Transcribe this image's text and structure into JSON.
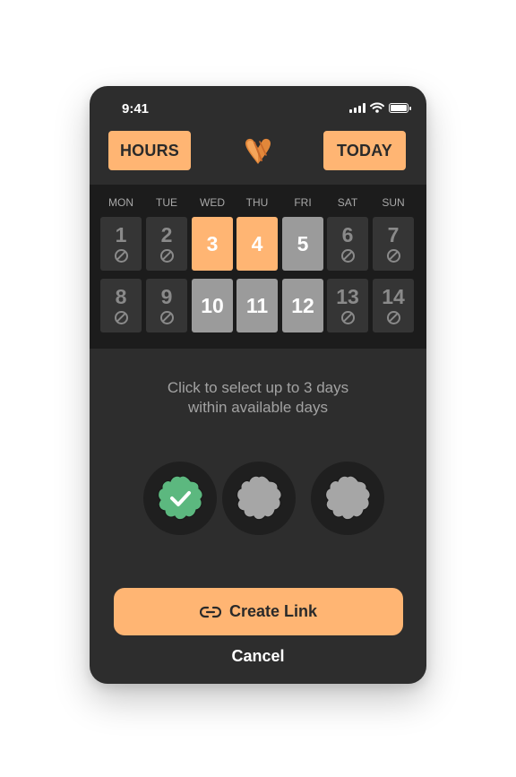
{
  "status_bar": {
    "time": "9:41"
  },
  "header": {
    "left_button": "HOURS",
    "right_button": "TODAY",
    "logo_icon": "heart-v-logo-icon"
  },
  "calendar": {
    "weekdays": [
      "MON",
      "TUE",
      "WED",
      "THU",
      "FRI",
      "SAT",
      "SUN"
    ],
    "weeks": [
      [
        {
          "day": "1",
          "state": "unavailable"
        },
        {
          "day": "2",
          "state": "unavailable"
        },
        {
          "day": "3",
          "state": "selected"
        },
        {
          "day": "4",
          "state": "selected"
        },
        {
          "day": "5",
          "state": "available"
        },
        {
          "day": "6",
          "state": "unavailable"
        },
        {
          "day": "7",
          "state": "unavailable"
        }
      ],
      [
        {
          "day": "8",
          "state": "unavailable"
        },
        {
          "day": "9",
          "state": "unavailable"
        },
        {
          "day": "10",
          "state": "available"
        },
        {
          "day": "11",
          "state": "available"
        },
        {
          "day": "12",
          "state": "available"
        },
        {
          "day": "13",
          "state": "unavailable"
        },
        {
          "day": "14",
          "state": "unavailable"
        }
      ]
    ]
  },
  "instructions": {
    "line1": "Click to select up to 3 days",
    "line2": "within available days"
  },
  "slots": [
    {
      "state": "checked",
      "icon": "verified-badge-check-icon"
    },
    {
      "state": "empty",
      "icon": "badge-placeholder-icon"
    },
    {
      "state": "empty",
      "icon": "badge-placeholder-icon"
    }
  ],
  "actions": {
    "create_link": "Create Link",
    "cancel": "Cancel",
    "link_icon": "link-icon"
  },
  "colors": {
    "accent": "#ffb573",
    "background": "#2d2d2d",
    "calendar_bg": "#1c1c1c",
    "available": "#9b9b9b",
    "success": "#5cb87f"
  }
}
